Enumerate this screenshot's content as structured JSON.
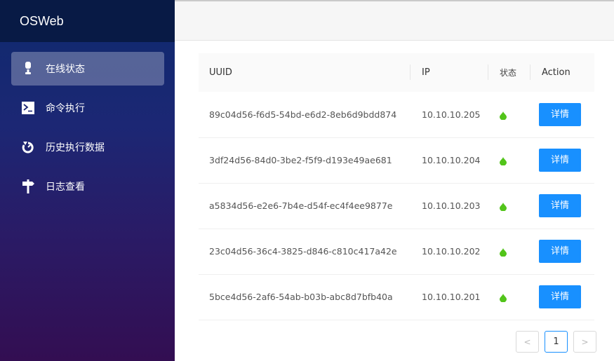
{
  "app": {
    "title": "OSWeb"
  },
  "sidebar": {
    "items": [
      {
        "label": "在线状态",
        "icon": "online-status-icon",
        "active": true
      },
      {
        "label": "命令执行",
        "icon": "terminal-icon",
        "active": false
      },
      {
        "label": "历史执行数据",
        "icon": "history-icon",
        "active": false
      },
      {
        "label": "日志查看",
        "icon": "signpost-icon",
        "active": false
      }
    ]
  },
  "table": {
    "headers": {
      "uuid": "UUID",
      "ip": "IP",
      "status": "状态",
      "action": "Action"
    },
    "rows": [
      {
        "uuid": "89c04d56-f6d5-54bd-e6d2-8eb6d9bdd874",
        "ip": "10.10.10.205",
        "status": "online",
        "action": "详情"
      },
      {
        "uuid": "3df24d56-84d0-3be2-f5f9-d193e49ae681",
        "ip": "10.10.10.204",
        "status": "online",
        "action": "详情"
      },
      {
        "uuid": "a5834d56-e2e6-7b4e-d54f-ec4f4ee9877e",
        "ip": "10.10.10.203",
        "status": "online",
        "action": "详情"
      },
      {
        "uuid": "23c04d56-36c4-3825-d846-c810c417a42e",
        "ip": "10.10.10.202",
        "status": "online",
        "action": "详情"
      },
      {
        "uuid": "5bce4d56-2af6-54ab-b03b-abc8d7bfb40a",
        "ip": "10.10.10.201",
        "status": "online",
        "action": "详情"
      }
    ]
  },
  "pagination": {
    "prev": "<",
    "current_page": "1",
    "next": ">"
  },
  "colors": {
    "accent": "#1890ff",
    "status_online": "#52c41a"
  }
}
